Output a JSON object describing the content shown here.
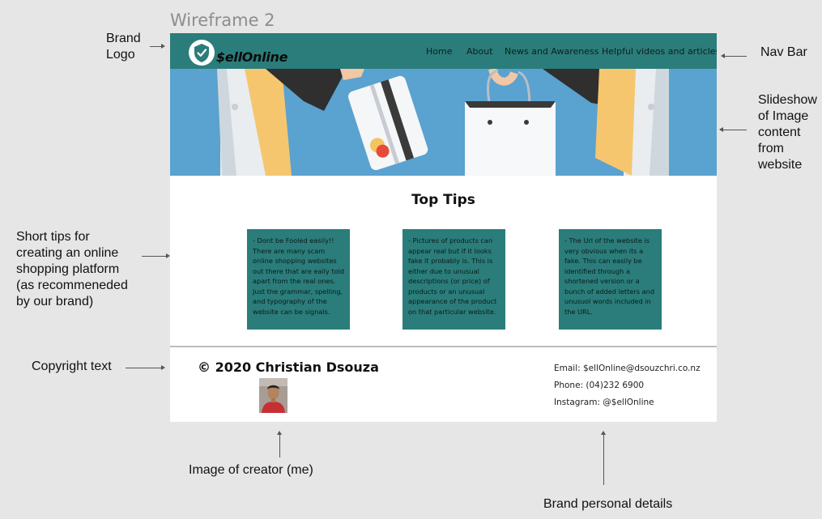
{
  "frame_title": "Wireframe 2",
  "annotations": {
    "brand_logo": [
      "Brand",
      "Logo"
    ],
    "nav_bar": "Nav Bar",
    "slideshow": [
      "Slideshow",
      "of Image",
      "content",
      "from",
      "website"
    ],
    "short_tips": [
      "Short tips for",
      "creating an online",
      "shopping platform",
      "(as recommeneded",
      "by our brand)"
    ],
    "copyright_text": "Copyright text",
    "image_of_creator": "Image of creator (me)",
    "brand_personal_details": "Brand personal details"
  },
  "brand": {
    "logo_text": "$ellOnline"
  },
  "nav": {
    "items": [
      {
        "label": "Home"
      },
      {
        "label": "About"
      },
      {
        "label": "News and Awareness"
      },
      {
        "label": "Helpful videos and articles"
      }
    ]
  },
  "tips": {
    "title": "Top Tips",
    "cards": [
      {
        "text": "-  Dont be Fooled easily!! There are many scam online shopping websites out there that are eaily told apart from the real ones. Just the grammar, spelling, and typography of the website can be signals."
      },
      {
        "text": "- Pictures of products can appear real but if it looks fake it probably is. This is either due to unusual descriptions (or price) of products or an unusual appearance of the product on that particular website."
      },
      {
        "text": "- The Url of the website is very obvious when its a fake. This can easily be identified through a shortened version or a bunch of added letters and unusuol words included in the URL."
      }
    ]
  },
  "footer": {
    "copyright": "© 2020 Christian Dsouza",
    "contact": {
      "email": "Email: $ellOnline@dsouzchri.co.nz",
      "phone": "Phone: (04)232 6900",
      "instagram": "Instagram: @$ellOnline"
    }
  },
  "colors": {
    "teal": "#2a7d7a",
    "hero_blue": "#5aa2cf",
    "background": "#e6e6e6"
  }
}
